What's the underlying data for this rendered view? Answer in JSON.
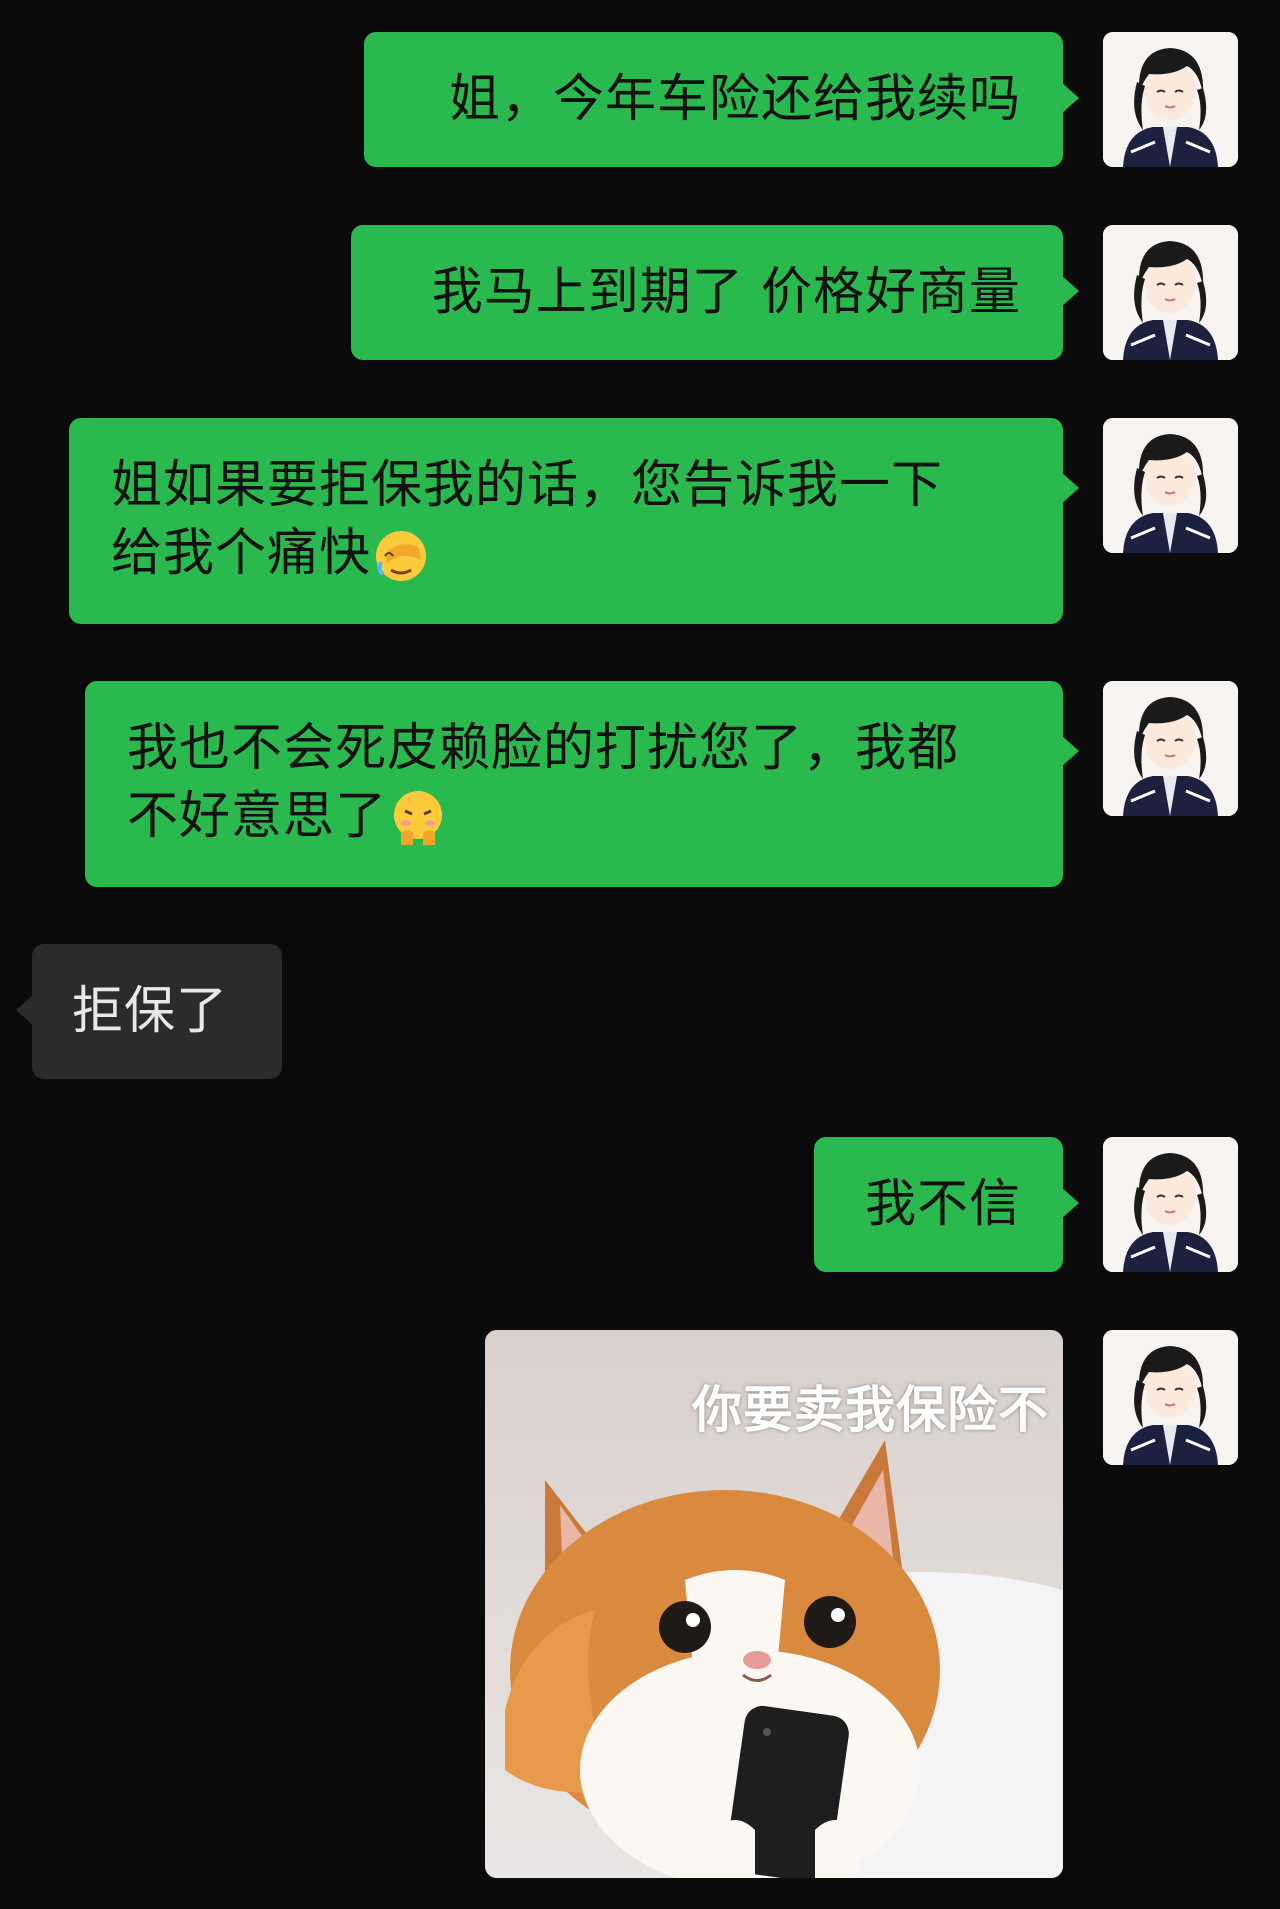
{
  "messages": [
    {
      "id": "m1",
      "side": "out",
      "text": "姐，今年车险还给我续吗"
    },
    {
      "id": "m2",
      "side": "out",
      "text": "我马上到期了 价格好商量"
    },
    {
      "id": "m3",
      "side": "out",
      "line1": "姐如果要拒保我的话，您告诉我一下",
      "line2": "给我个痛快",
      "emoji": "facepalm-emoji"
    },
    {
      "id": "m4",
      "side": "out",
      "line1": "我也不会死皮赖脸的打扰您了，我都",
      "line2": "不好意思了",
      "emoji": "shy-face-emoji"
    },
    {
      "id": "m5",
      "side": "in",
      "text": "拒保了"
    },
    {
      "id": "m6",
      "side": "out",
      "text": "我不信"
    },
    {
      "id": "m7",
      "side": "out",
      "type": "sticker",
      "caption": "你要卖我保险不",
      "subject": "orange-white cat holding a phone"
    }
  ],
  "colors": {
    "background": "#0b0b0b",
    "outgoing_bubble": "#29b94e",
    "incoming_bubble": "#2b2b2b",
    "incoming_text": "#e8e8e8",
    "outgoing_text": "#111111"
  },
  "icons": {
    "avatar": "user-avatar-anime-girl",
    "emoji_m3": "face-with-hand-over-eyes",
    "emoji_m4": "pouting-shy-face"
  }
}
